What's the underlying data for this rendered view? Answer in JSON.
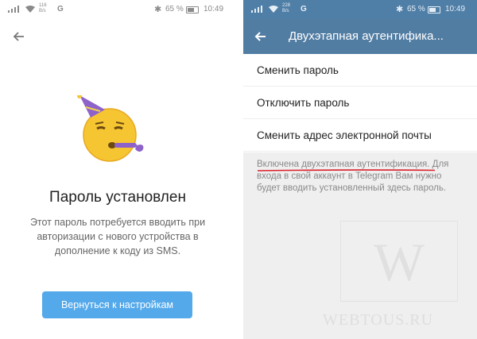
{
  "left": {
    "status": {
      "speed": "116\nB/s",
      "network": "G",
      "battery": "65 %",
      "time": "10:49"
    },
    "title": "Пароль установлен",
    "description": "Этот пароль потребуется вводить при авторизации с нового устройства в дополнение к коду из SMS.",
    "button_label": "Вернуться к настройкам",
    "icons": {
      "back": "arrow-left-icon",
      "emoji": "party-face-emoji"
    },
    "colors": {
      "button": "#54a9eb"
    }
  },
  "right": {
    "status": {
      "speed": "228\nB/s",
      "network": "G",
      "battery": "65 %",
      "time": "10:49"
    },
    "title": "Двухэтапная аутентифика...",
    "menu": [
      "Сменить пароль",
      "Отключить пароль",
      "Сменить адрес электронной почты"
    ],
    "info": {
      "highlight": "Включена двухэтапная аутентификация.",
      "rest": "Для входа в свой аккаунт в Telegram Вам нужно будет вводить установленный здесь пароль."
    },
    "watermark_letter": "W",
    "watermark_text": "WEBTOUS.RU",
    "colors": {
      "appbar": "#527da3",
      "underline": "#d9202a"
    }
  }
}
